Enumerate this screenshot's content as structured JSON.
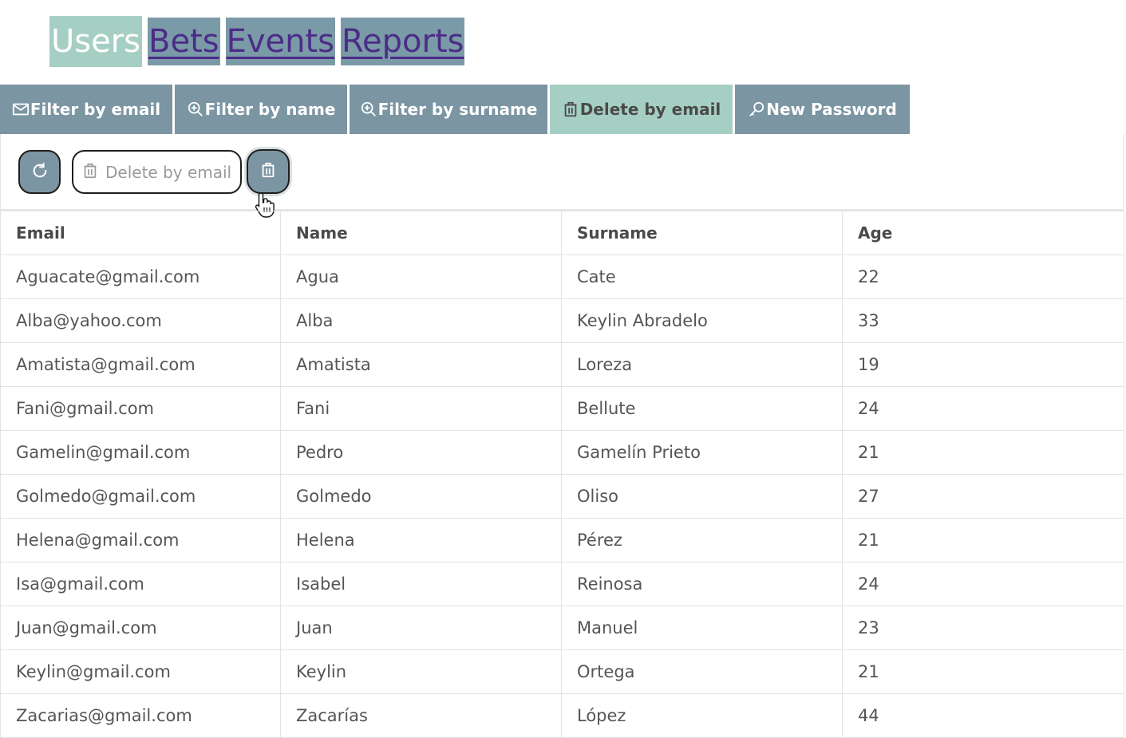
{
  "nav": {
    "items": [
      {
        "label": "Users",
        "active": true
      },
      {
        "label": "Bets",
        "active": false
      },
      {
        "label": "Events",
        "active": false
      },
      {
        "label": "Reports",
        "active": false
      }
    ]
  },
  "tabs": [
    {
      "label": "Filter by email",
      "icon": "envelope-icon",
      "active": false
    },
    {
      "label": "Filter by name",
      "icon": "zoom-in-icon",
      "active": false
    },
    {
      "label": "Filter by surname",
      "icon": "zoom-in-icon",
      "active": false
    },
    {
      "label": "Delete by email",
      "icon": "trash-icon",
      "active": true
    },
    {
      "label": "New Password",
      "icon": "key-icon",
      "active": false
    }
  ],
  "toolbar": {
    "refresh_icon": "refresh-icon",
    "search_placeholder": "Delete by email",
    "search_value": "",
    "delete_icon": "trash-icon"
  },
  "table": {
    "columns": [
      "Email",
      "Name",
      "Surname",
      "Age"
    ],
    "rows": [
      [
        "Aguacate@gmail.com",
        "Agua",
        "Cate",
        "22"
      ],
      [
        "Alba@yahoo.com",
        "Alba",
        "Keylin Abradelo",
        "33"
      ],
      [
        "Amatista@gmail.com",
        "Amatista",
        "Loreza",
        "19"
      ],
      [
        "Fani@gmail.com",
        "Fani",
        "Bellute",
        "24"
      ],
      [
        "Gamelin@gmail.com",
        "Pedro",
        "Gamelín Prieto",
        "21"
      ],
      [
        "Golmedo@gmail.com",
        "Golmedo",
        "Oliso",
        "27"
      ],
      [
        "Helena@gmail.com",
        "Helena",
        "Pérez",
        "21"
      ],
      [
        "Isa@gmail.com",
        "Isabel",
        "Reinosa",
        "24"
      ],
      [
        "Juan@gmail.com",
        "Juan",
        "Manuel",
        "23"
      ],
      [
        "Keylin@gmail.com",
        "Keylin",
        "Ortega",
        "21"
      ],
      [
        "Zacarias@gmail.com",
        "Zacarías",
        "López",
        "44"
      ]
    ]
  },
  "colors": {
    "accent_active": "#a6cfc4",
    "tab_background": "#7b95a2",
    "link_color": "#4b2c88"
  }
}
